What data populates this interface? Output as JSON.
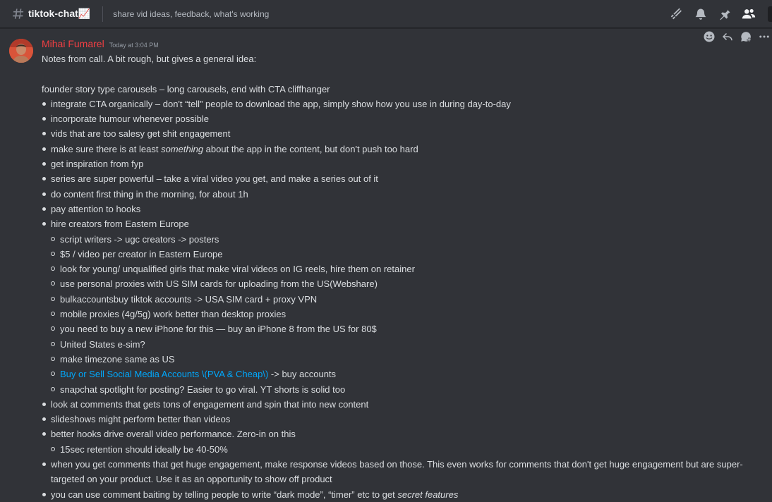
{
  "channel": {
    "name": "tiktok-chat",
    "emoji": "📈",
    "topic": "share vid ideas, feedback, what's working"
  },
  "header_icons": [
    "threads-icon",
    "bell-icon",
    "pin-icon",
    "members-icon"
  ],
  "message": {
    "author": "Mihai Fumarel",
    "author_color": "#f23f43",
    "timestamp": "Today at 3:04 PM",
    "intro": "Notes from call. A bit rough, but gives a general idea:",
    "heading": "founder story type carousels – long carousels, end with CTA cliffhanger",
    "items": [
      "integrate CTA organically – don't “tell” people to download the app, simply show how you use in during day-to-day",
      "incorporate humour whenever possible",
      "vids that are too salesy get shit engagement",
      {
        "before": "make sure there is at least ",
        "em": "something",
        "after": " about the app in the content, but don't push too hard"
      },
      "get inspiration from fyp",
      "series are super powerful – take a viral video you get, and make a series out of it",
      "do content first thing in the morning, for about 1h",
      "pay attention to hooks",
      "hire creators from Eastern Europe"
    ],
    "sub_items": [
      "script writers -> ugc creators -> posters",
      "$5 / video per creator in Eastern Europe",
      "look for young/ unqualified girls that make viral videos on IG reels, hire them on retainer",
      "use personal proxies with US SIM cards for uploading from the US(Webshare)",
      "bulkaccountsbuy tiktok accounts -> USA SIM card + proxy VPN",
      "mobile proxies (4g/5g) work better than desktop proxies",
      "you need to buy a new iPhone for this — buy an iPhone 8 from the US for 80$",
      "United States e-sim?",
      "make timezone same as US",
      {
        "link": "Buy or Sell Social Media Accounts \\(PVA & Cheap\\)",
        "after": " -> buy accounts"
      },
      "snapchat spotlight for posting? Easier to go viral. YT shorts is solid too"
    ],
    "items_after": [
      "look at comments that gets tons of engagement and spin that into new content",
      "slideshows might perform better than videos",
      "better hooks drive overall video performance. Zero-in on this"
    ],
    "sub_items_2": [
      "15sec retention should ideally be 40-50%"
    ],
    "items_last": [
      "when you get comments that get huge engagement, make response videos based on those. This even works for comments that don't get huge engagement  but are super-targeted on your product. Use it as an opportunity to show off product",
      {
        "before": "you can use comment baiting by telling people to write “dark mode”, “timer” etc to get ",
        "em": "secret features",
        "after": ""
      }
    ]
  },
  "hover_actions": [
    "add-reaction-icon",
    "reply-icon",
    "create-thread-icon",
    "more-icon"
  ]
}
